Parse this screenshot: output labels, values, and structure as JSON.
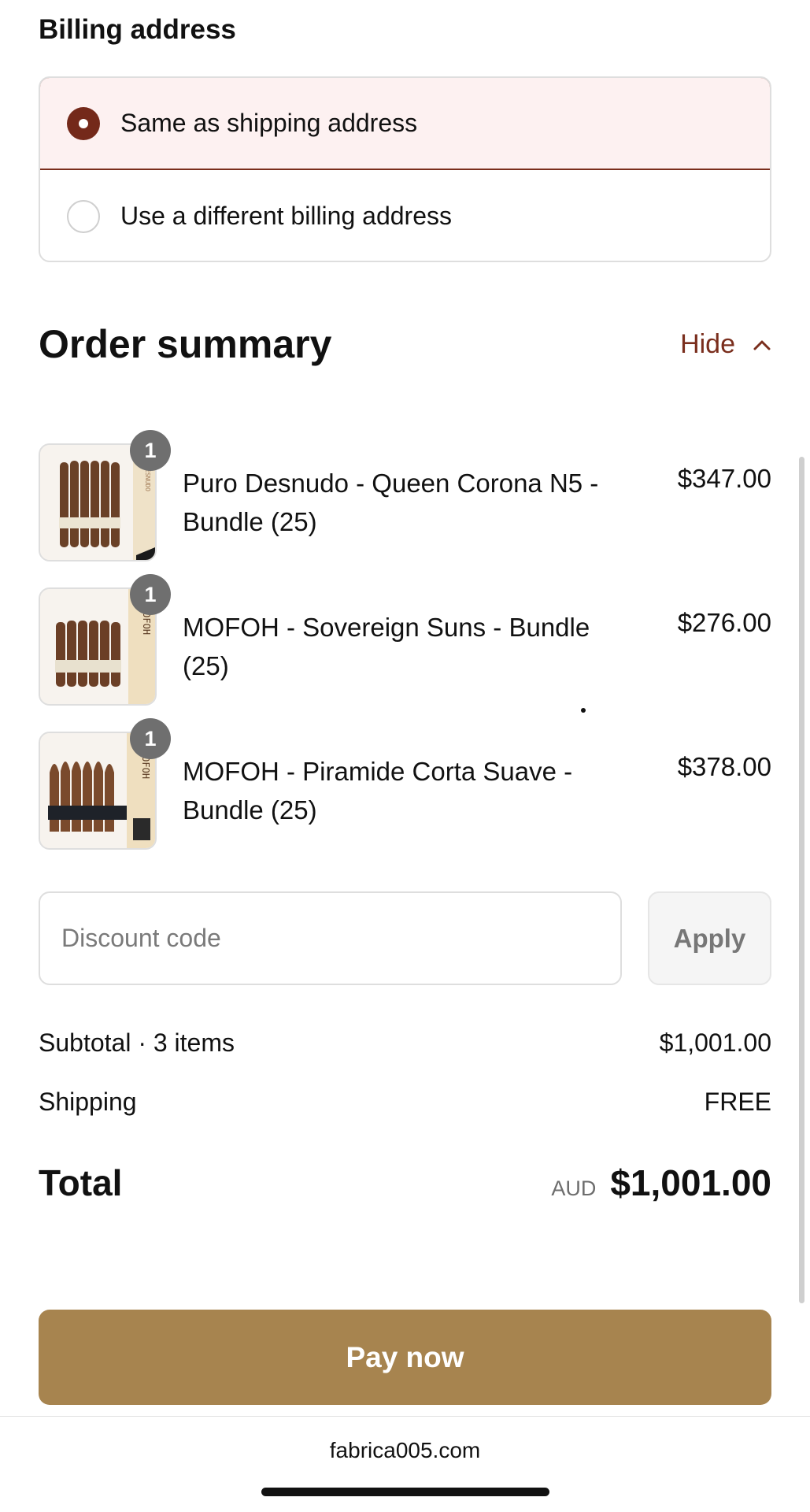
{
  "billing": {
    "title": "Billing address",
    "options": [
      {
        "label": "Same as shipping address",
        "selected": true
      },
      {
        "label": "Use a different billing address",
        "selected": false
      }
    ]
  },
  "summary": {
    "title": "Order summary",
    "toggle_label": "Hide",
    "toggle_icon": "chevron-up-icon"
  },
  "items": [
    {
      "name": "Puro Desnudo - Queen Corona N5 - Bundle (25)",
      "price": "$347.00",
      "quantity": "1",
      "thumb_side_text": "PURO DESNUDO"
    },
    {
      "name": "MOFOH - Sovereign Suns - Bundle (25)",
      "price": "$276.00",
      "quantity": "1",
      "thumb_side_text": "MOFOH"
    },
    {
      "name": "MOFOH - Piramide Corta Suave - Bundle (25)",
      "price": "$378.00",
      "quantity": "1",
      "thumb_side_text": "MOFOH"
    }
  ],
  "discount": {
    "placeholder": "Discount code",
    "value": "",
    "apply_label": "Apply"
  },
  "totals": {
    "subtotal_label": "Subtotal · 3 items",
    "subtotal_value": "$1,001.00",
    "shipping_label": "Shipping",
    "shipping_value": "FREE",
    "total_label": "Total",
    "currency": "AUD",
    "total_value": "$1,001.00"
  },
  "pay_button_label": "Pay now",
  "footer": {
    "domain": "fabrica005.com"
  },
  "colors": {
    "accent": "#7a2e1d",
    "selected_bg": "#fdf1f1",
    "pay_button": "#a7844f",
    "badge": "#6f6f6f"
  }
}
